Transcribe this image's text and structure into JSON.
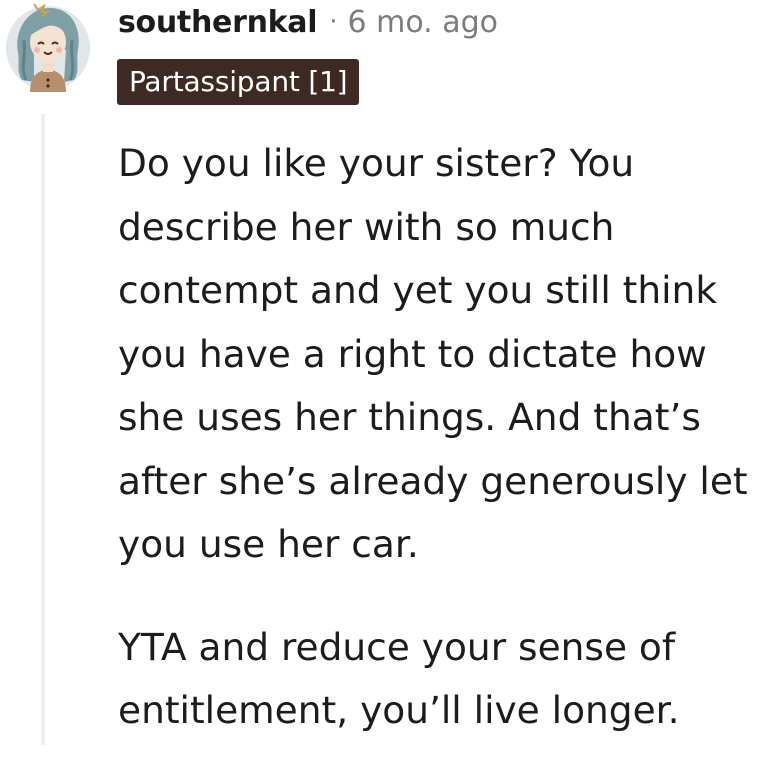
{
  "comment": {
    "username": "southernkal",
    "separator": "·",
    "timestamp": "6 mo. ago",
    "flair": "Partassipant [1]",
    "avatar_icon": "user-avatar-icon",
    "paragraphs": [
      "Do you like your sister? You describe her with so much contempt and yet you still think you have a right to dictate how she uses her things. And that’s after she’s already generously let you use her car.",
      "YTA and reduce your sense of entitlement, you’ll live longer."
    ]
  },
  "colors": {
    "flair_bg": "#3e2a22",
    "flair_text": "#ffffff",
    "meta_text": "#7c7c7c",
    "body_text": "#1c1c1c",
    "thread_line": "#edeff1",
    "avatar_bg": "#e2e6e9",
    "avatar_hair": "#7da0a6"
  }
}
